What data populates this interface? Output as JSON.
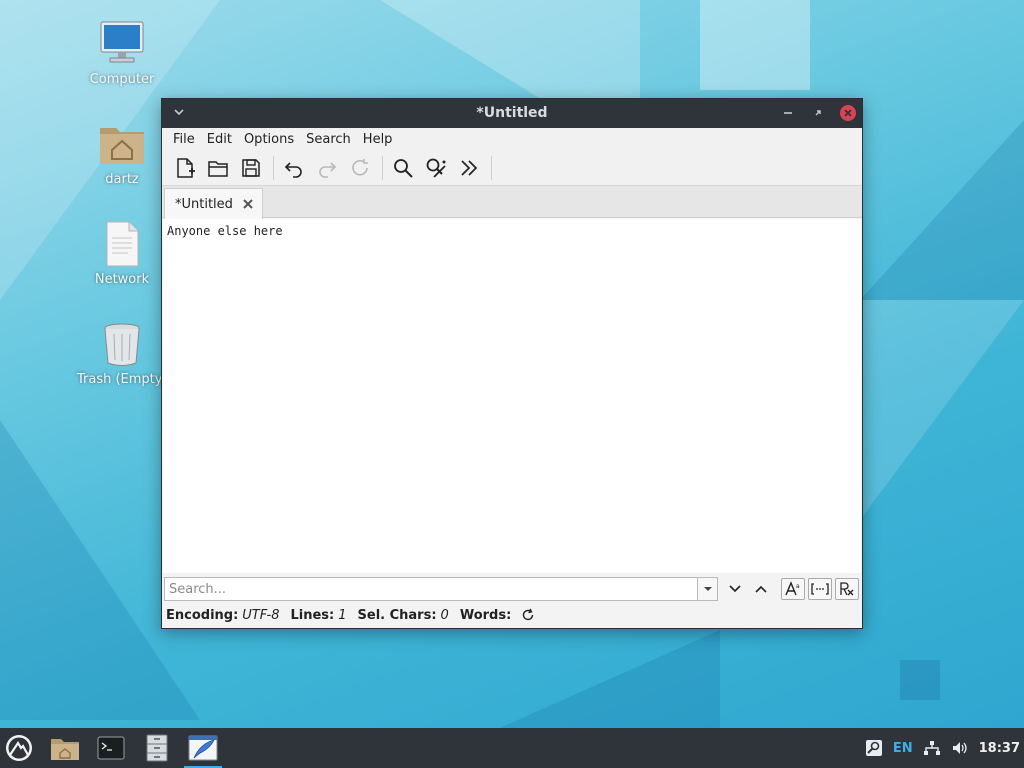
{
  "desktop": {
    "icons": [
      {
        "label": "Computer"
      },
      {
        "label": "dartz"
      },
      {
        "label": "Network"
      },
      {
        "label": "Trash (Empty)"
      }
    ]
  },
  "window": {
    "title": "*Untitled",
    "menu": [
      "File",
      "Edit",
      "Options",
      "Search",
      "Help"
    ],
    "tab_label": "*Untitled",
    "editor_text": "Anyone else here",
    "search_placeholder": "Search...",
    "status": {
      "encoding_label": "Encoding:",
      "encoding_value": "UTF-8",
      "lines_label": "Lines:",
      "lines_value": "1",
      "sel_label": "Sel. Chars:",
      "sel_value": "0",
      "words_label": "Words:"
    }
  },
  "taskbar": {
    "language": "EN",
    "clock": "18:37"
  },
  "colors": {
    "titlebar": "#2f343a",
    "accent": "#3daee9",
    "close_button": "#da4453"
  }
}
